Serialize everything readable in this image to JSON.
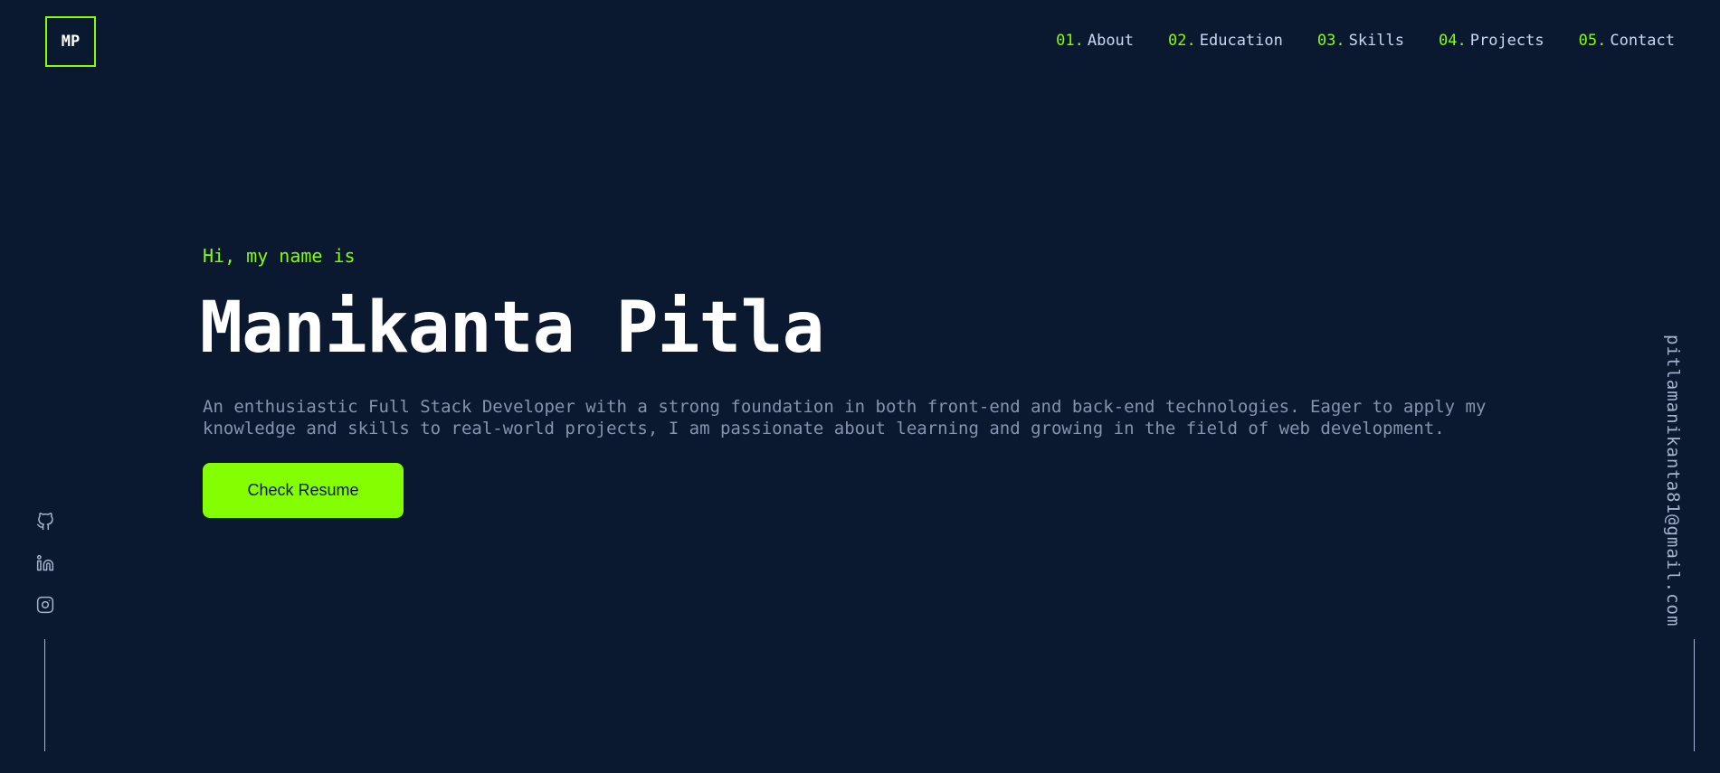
{
  "logo": {
    "text": "MP"
  },
  "nav": {
    "items": [
      {
        "num": "01.",
        "label": "About"
      },
      {
        "num": "02.",
        "label": "Education"
      },
      {
        "num": "03.",
        "label": "Skills"
      },
      {
        "num": "04.",
        "label": "Projects"
      },
      {
        "num": "05.",
        "label": "Contact"
      }
    ]
  },
  "hero": {
    "greeting": "Hi, my name is",
    "name": "Manikanta Pitla",
    "bio": "An enthusiastic Full Stack Developer with a strong foundation in both front-end and back-end technologies. Eager to apply my knowledge and skills to real-world projects, I am passionate about learning and growing in the field of web development.",
    "resume_label": "Check Resume"
  },
  "socials": {
    "icons": [
      "github-icon",
      "linkedin-icon",
      "instagram-icon"
    ]
  },
  "email": "pitlamanikanta81@gmail.com",
  "colors": {
    "background": "#0a192f",
    "accent": "#84ff01",
    "text_light": "#ccd6f6",
    "text_muted": "#8892b0",
    "heading": "#ffffff"
  }
}
